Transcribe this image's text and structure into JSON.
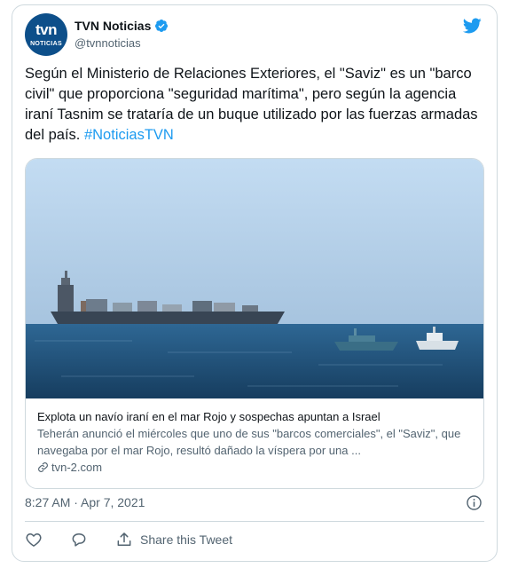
{
  "account": {
    "name": "TVN Noticias",
    "handle": "@tvnnoticias",
    "avatar_main": "tvn",
    "avatar_sub": "NOTICIAS",
    "verified": true
  },
  "tweet": {
    "text": "Según el Ministerio de Relaciones Exteriores, el \"Saviz\" es un \"barco civil\" que proporciona \"seguridad marítima\", pero según la agencia iraní Tasnim se trataría de un buque utilizado por las fuerzas armadas del país. ",
    "hashtag": "#NoticiasTVN"
  },
  "link_card": {
    "title": "Explota un navío iraní en el mar Rojo y sospechas apuntan a Israel",
    "description": "Teherán anunció el miércoles que uno de sus \"barcos comerciales\", el \"Saviz\", que navegaba por el mar Rojo, resultó dañado la víspera por una ...",
    "domain": "tvn-2.com"
  },
  "timestamp": "8:27 AM · Apr 7, 2021",
  "actions": {
    "share_label": "Share this Tweet"
  },
  "icons": [
    "twitter-bird-icon",
    "verified-badge-icon",
    "info-icon",
    "heart-icon",
    "reply-icon",
    "share-icon",
    "link-icon"
  ],
  "colors": {
    "accent": "#1d9bf0",
    "text": "#0f1419",
    "secondary": "#536471",
    "border": "#cfd9de"
  }
}
